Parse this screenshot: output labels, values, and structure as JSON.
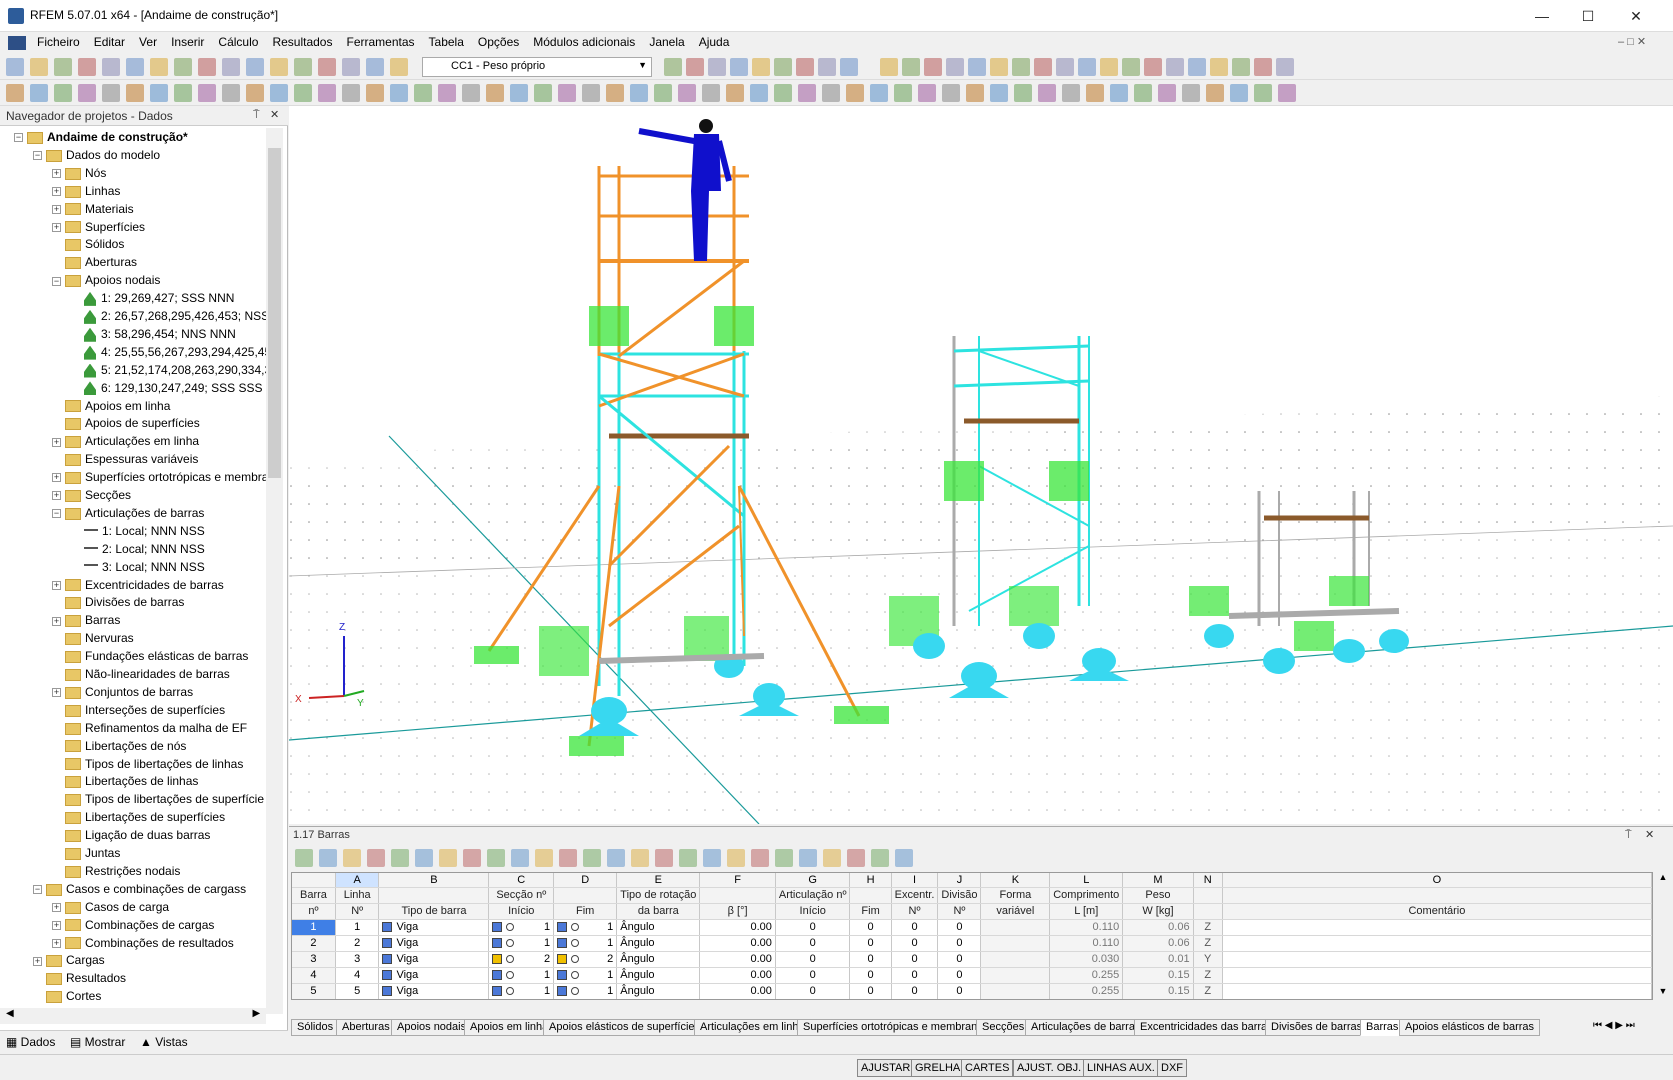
{
  "window": {
    "title": "RFEM 5.07.01 x64 - [Andaime de construção*]"
  },
  "menu": [
    "Ficheiro",
    "Editar",
    "Ver",
    "Inserir",
    "Cálculo",
    "Resultados",
    "Ferramentas",
    "Tabela",
    "Opções",
    "Módulos adicionais",
    "Janela",
    "Ajuda"
  ],
  "toolbar": {
    "load_case": "CC1 - Peso próprio"
  },
  "navigator": {
    "title": "Navegador de projetos - Dados",
    "tree": [
      {
        "label": "Andaime de construção*",
        "level": 0,
        "kind": "root",
        "exp": "-"
      },
      {
        "label": "Dados do modelo",
        "level": 1,
        "kind": "folder",
        "exp": "-"
      },
      {
        "label": "Nós",
        "level": 2,
        "kind": "folder",
        "exp": "+"
      },
      {
        "label": "Linhas",
        "level": 2,
        "kind": "folder",
        "exp": "+"
      },
      {
        "label": "Materiais",
        "level": 2,
        "kind": "folder",
        "exp": "+"
      },
      {
        "label": "Superfícies",
        "level": 2,
        "kind": "folder",
        "exp": "+"
      },
      {
        "label": "Sólidos",
        "level": 2,
        "kind": "folder",
        "exp": ""
      },
      {
        "label": "Aberturas",
        "level": 2,
        "kind": "folder",
        "exp": ""
      },
      {
        "label": "Apoios nodais",
        "level": 2,
        "kind": "folder",
        "exp": "-"
      },
      {
        "label": "1: 29,269,427; SSS NNN",
        "level": 3,
        "kind": "support",
        "exp": ""
      },
      {
        "label": "2: 26,57,268,295,426,453; NSS N",
        "level": 3,
        "kind": "support",
        "exp": ""
      },
      {
        "label": "3: 58,296,454; NNS NNN",
        "level": 3,
        "kind": "support",
        "exp": ""
      },
      {
        "label": "4: 25,55,56,267,293,294,425,451,",
        "level": 3,
        "kind": "support",
        "exp": ""
      },
      {
        "label": "5: 21,52,174,208,263,290,334,36",
        "level": 3,
        "kind": "support",
        "exp": ""
      },
      {
        "label": "6: 129,130,247,249; SSS SSS",
        "level": 3,
        "kind": "support",
        "exp": ""
      },
      {
        "label": "Apoios em linha",
        "level": 2,
        "kind": "folder",
        "exp": ""
      },
      {
        "label": "Apoios de superfícies",
        "level": 2,
        "kind": "folder",
        "exp": ""
      },
      {
        "label": "Articulações em linha",
        "level": 2,
        "kind": "folder",
        "exp": "+"
      },
      {
        "label": "Espessuras variáveis",
        "level": 2,
        "kind": "folder",
        "exp": ""
      },
      {
        "label": "Superfícies ortotrópicas e membra",
        "level": 2,
        "kind": "folder",
        "exp": "+"
      },
      {
        "label": "Secções",
        "level": 2,
        "kind": "folder",
        "exp": "+"
      },
      {
        "label": "Articulações de barras",
        "level": 2,
        "kind": "folder",
        "exp": "-"
      },
      {
        "label": "1: Local; NNN NSS",
        "level": 3,
        "kind": "hinge",
        "exp": ""
      },
      {
        "label": "2: Local; NNN NSS",
        "level": 3,
        "kind": "hinge",
        "exp": ""
      },
      {
        "label": "3: Local; NNN NSS",
        "level": 3,
        "kind": "hinge",
        "exp": ""
      },
      {
        "label": "Excentricidades de barras",
        "level": 2,
        "kind": "folder",
        "exp": "+"
      },
      {
        "label": "Divisões de barras",
        "level": 2,
        "kind": "folder",
        "exp": ""
      },
      {
        "label": "Barras",
        "level": 2,
        "kind": "folder",
        "exp": "+"
      },
      {
        "label": "Nervuras",
        "level": 2,
        "kind": "folder",
        "exp": ""
      },
      {
        "label": "Fundações elásticas de barras",
        "level": 2,
        "kind": "folder",
        "exp": ""
      },
      {
        "label": "Não-linearidades de barras",
        "level": 2,
        "kind": "folder",
        "exp": ""
      },
      {
        "label": "Conjuntos de barras",
        "level": 2,
        "kind": "folder",
        "exp": "+"
      },
      {
        "label": "Interseções de superfícies",
        "level": 2,
        "kind": "folder",
        "exp": ""
      },
      {
        "label": "Refinamentos da malha de EF",
        "level": 2,
        "kind": "folder",
        "exp": ""
      },
      {
        "label": "Libertações de nós",
        "level": 2,
        "kind": "folder",
        "exp": ""
      },
      {
        "label": "Tipos de libertações de linhas",
        "level": 2,
        "kind": "folder",
        "exp": ""
      },
      {
        "label": "Libertações de linhas",
        "level": 2,
        "kind": "folder",
        "exp": ""
      },
      {
        "label": "Tipos de libertações de superfície",
        "level": 2,
        "kind": "folder",
        "exp": ""
      },
      {
        "label": "Libertações de superfícies",
        "level": 2,
        "kind": "folder",
        "exp": ""
      },
      {
        "label": "Ligação de duas barras",
        "level": 2,
        "kind": "folder",
        "exp": ""
      },
      {
        "label": "Juntas",
        "level": 2,
        "kind": "folder",
        "exp": ""
      },
      {
        "label": "Restrições nodais",
        "level": 2,
        "kind": "folder",
        "exp": ""
      },
      {
        "label": "Casos e combinações de cargass",
        "level": 1,
        "kind": "folder",
        "exp": "-"
      },
      {
        "label": "Casos de carga",
        "level": 2,
        "kind": "folder",
        "exp": "+"
      },
      {
        "label": "Combinações de cargas",
        "level": 2,
        "kind": "folder",
        "exp": "+"
      },
      {
        "label": "Combinações de resultados",
        "level": 2,
        "kind": "folder",
        "exp": "+"
      },
      {
        "label": "Cargas",
        "level": 1,
        "kind": "folder",
        "exp": "+"
      },
      {
        "label": "Resultados",
        "level": 1,
        "kind": "folder",
        "exp": ""
      },
      {
        "label": "Cortes",
        "level": 1,
        "kind": "folder",
        "exp": ""
      }
    ],
    "tabs": [
      "Dados",
      "Mostrar",
      "Vistas"
    ]
  },
  "table": {
    "title": "1.17 Barras",
    "letters": [
      "A",
      "B",
      "C",
      "D",
      "E",
      "F",
      "G",
      "H",
      "I",
      "J",
      "K",
      "L",
      "M",
      "N",
      "O"
    ],
    "head1": [
      "Barra",
      "Linha",
      "",
      "Secção nº",
      "",
      "Tipo de rotação",
      "",
      "Articulação nº",
      "",
      "Excentr.",
      "Divisão",
      "Forma",
      "Comprimento",
      "Peso",
      "",
      ""
    ],
    "head2": [
      "nº",
      "Nº",
      "Tipo de barra",
      "Início",
      "Fim",
      "da barra",
      "β [°]",
      "Início",
      "Fim",
      "Nº",
      "Nº",
      "variável",
      "L [m]",
      "W [kg]",
      "",
      "Comentário"
    ],
    "rows": [
      {
        "n": "1",
        "line": "1",
        "type": "Viga",
        "s1": "1",
        "s2": "1",
        "rot": "Ângulo",
        "beta": "0.00",
        "a1": "0",
        "a2": "0",
        "ex": "0",
        "div": "0",
        "L": "0.110",
        "W": "0.06",
        "ax": "Z",
        "c1": "#4b78d8",
        "c2": "#4b78d8"
      },
      {
        "n": "2",
        "line": "2",
        "type": "Viga",
        "s1": "1",
        "s2": "1",
        "rot": "Ângulo",
        "beta": "0.00",
        "a1": "0",
        "a2": "0",
        "ex": "0",
        "div": "0",
        "L": "0.110",
        "W": "0.06",
        "ax": "Z",
        "c1": "#4b78d8",
        "c2": "#4b78d8"
      },
      {
        "n": "3",
        "line": "3",
        "type": "Viga",
        "s1": "2",
        "s2": "2",
        "rot": "Ângulo",
        "beta": "0.00",
        "a1": "0",
        "a2": "0",
        "ex": "0",
        "div": "0",
        "L": "0.030",
        "W": "0.01",
        "ax": "Y",
        "c1": "#f0c000",
        "c2": "#f0c000"
      },
      {
        "n": "4",
        "line": "4",
        "type": "Viga",
        "s1": "1",
        "s2": "1",
        "rot": "Ângulo",
        "beta": "0.00",
        "a1": "0",
        "a2": "0",
        "ex": "0",
        "div": "0",
        "L": "0.255",
        "W": "0.15",
        "ax": "Z",
        "c1": "#4b78d8",
        "c2": "#4b78d8"
      },
      {
        "n": "5",
        "line": "5",
        "type": "Viga",
        "s1": "1",
        "s2": "1",
        "rot": "Ângulo",
        "beta": "0.00",
        "a1": "0",
        "a2": "0",
        "ex": "0",
        "div": "0",
        "L": "0.255",
        "W": "0.15",
        "ax": "Z",
        "c1": "#4b78d8",
        "c2": "#4b78d8"
      }
    ]
  },
  "bottom_tabs": [
    "Sólidos",
    "Aberturas",
    "Apoios nodais",
    "Apoios em linha",
    "Apoios elásticos de superfícies",
    "Articulações em linha",
    "Superfícies ortotrópicas e membranas",
    "Secções",
    "Articulações de barras",
    "Excentricidades das barras",
    "Divisões de barras",
    "Barras",
    "Apoios elásticos de barras"
  ],
  "active_bottom_tab": "Barras",
  "status": [
    "AJUSTAR",
    "GRELHA",
    "CARTES",
    "AJUST. OBJ.",
    "LINHAS AUX.",
    "DXF"
  ],
  "axes": {
    "x": "X",
    "y": "Y",
    "z": "Z"
  },
  "colors": {
    "orange": "#f0922a",
    "cyan": "#2de3e0",
    "green": "#39e639",
    "support": "#38d8f0",
    "human": "#1010cc"
  }
}
